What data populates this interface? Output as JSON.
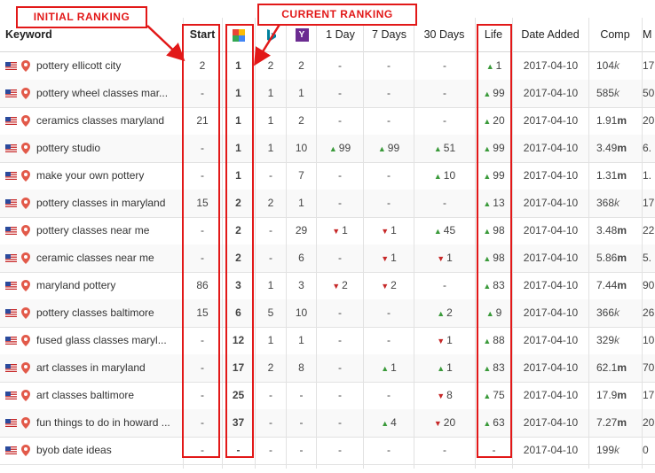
{
  "annotations": {
    "initial_label": "INITIAL RANKING",
    "current_label": "CURRENT RANKING"
  },
  "header": {
    "keyword": "Keyword",
    "start": "Start",
    "google_icon": "google-icon",
    "bing_icon": "bing-icon",
    "yahoo_icon": "yahoo-icon",
    "yahoo_glyph": "Y",
    "day1": "1 Day",
    "day7": "7 Days",
    "day30": "30 Days",
    "life": "Life",
    "date_added": "Date Added",
    "comp": "Comp",
    "m": "M"
  },
  "colors": {
    "accent_red": "#e21818",
    "up_green": "#3a9a3a",
    "down_red": "#c62828"
  },
  "rows": [
    {
      "keyword": "pottery ellicott city",
      "start": "2",
      "google": "1",
      "bing": "2",
      "yahoo": "2",
      "d1": {
        "dir": "",
        "val": "-"
      },
      "d7": {
        "dir": "",
        "val": "-"
      },
      "d30": {
        "dir": "",
        "val": "-"
      },
      "life": {
        "dir": "up",
        "val": "1"
      },
      "date": "2017-04-10",
      "comp_num": "104",
      "comp_unit": "k",
      "m": "17"
    },
    {
      "keyword": "pottery wheel classes mar...",
      "start": "-",
      "google": "1",
      "bing": "1",
      "yahoo": "1",
      "d1": {
        "dir": "",
        "val": "-"
      },
      "d7": {
        "dir": "",
        "val": "-"
      },
      "d30": {
        "dir": "",
        "val": "-"
      },
      "life": {
        "dir": "up",
        "val": "99"
      },
      "date": "2017-04-10",
      "comp_num": "585",
      "comp_unit": "k",
      "m": "50"
    },
    {
      "keyword": "ceramics classes maryland",
      "start": "21",
      "google": "1",
      "bing": "1",
      "yahoo": "2",
      "d1": {
        "dir": "",
        "val": "-"
      },
      "d7": {
        "dir": "",
        "val": "-"
      },
      "d30": {
        "dir": "",
        "val": "-"
      },
      "life": {
        "dir": "up",
        "val": "20"
      },
      "date": "2017-04-10",
      "comp_num": "1.91",
      "comp_unit": "m",
      "m": "20"
    },
    {
      "keyword": "pottery studio",
      "start": "-",
      "google": "1",
      "bing": "1",
      "yahoo": "10",
      "d1": {
        "dir": "up",
        "val": "99"
      },
      "d7": {
        "dir": "up",
        "val": "99"
      },
      "d30": {
        "dir": "up",
        "val": "51"
      },
      "life": {
        "dir": "up",
        "val": "99"
      },
      "date": "2017-04-10",
      "comp_num": "3.49",
      "comp_unit": "m",
      "m": "6."
    },
    {
      "keyword": "make your own pottery",
      "start": "-",
      "google": "1",
      "bing": "-",
      "yahoo": "7",
      "d1": {
        "dir": "",
        "val": "-"
      },
      "d7": {
        "dir": "",
        "val": "-"
      },
      "d30": {
        "dir": "up",
        "val": "10"
      },
      "life": {
        "dir": "up",
        "val": "99"
      },
      "date": "2017-04-10",
      "comp_num": "1.31",
      "comp_unit": "m",
      "m": "1."
    },
    {
      "keyword": "pottery classes in maryland",
      "start": "15",
      "google": "2",
      "bing": "2",
      "yahoo": "1",
      "d1": {
        "dir": "",
        "val": "-"
      },
      "d7": {
        "dir": "",
        "val": "-"
      },
      "d30": {
        "dir": "",
        "val": "-"
      },
      "life": {
        "dir": "up",
        "val": "13"
      },
      "date": "2017-04-10",
      "comp_num": "368",
      "comp_unit": "k",
      "m": "17"
    },
    {
      "keyword": "pottery classes near me",
      "start": "-",
      "google": "2",
      "bing": "-",
      "yahoo": "29",
      "d1": {
        "dir": "down",
        "val": "1"
      },
      "d7": {
        "dir": "down",
        "val": "1"
      },
      "d30": {
        "dir": "up",
        "val": "45"
      },
      "life": {
        "dir": "up",
        "val": "98"
      },
      "date": "2017-04-10",
      "comp_num": "3.48",
      "comp_unit": "m",
      "m": "22"
    },
    {
      "keyword": "ceramic classes near me",
      "start": "-",
      "google": "2",
      "bing": "-",
      "yahoo": "6",
      "d1": {
        "dir": "",
        "val": "-"
      },
      "d7": {
        "dir": "down",
        "val": "1"
      },
      "d30": {
        "dir": "down",
        "val": "1"
      },
      "life": {
        "dir": "up",
        "val": "98"
      },
      "date": "2017-04-10",
      "comp_num": "5.86",
      "comp_unit": "m",
      "m": "5."
    },
    {
      "keyword": "maryland pottery",
      "start": "86",
      "google": "3",
      "bing": "1",
      "yahoo": "3",
      "d1": {
        "dir": "down",
        "val": "2"
      },
      "d7": {
        "dir": "down",
        "val": "2"
      },
      "d30": {
        "dir": "",
        "val": "-"
      },
      "life": {
        "dir": "up",
        "val": "83"
      },
      "date": "2017-04-10",
      "comp_num": "7.44",
      "comp_unit": "m",
      "m": "90"
    },
    {
      "keyword": "pottery classes baltimore",
      "start": "15",
      "google": "6",
      "bing": "5",
      "yahoo": "10",
      "d1": {
        "dir": "",
        "val": "-"
      },
      "d7": {
        "dir": "",
        "val": "-"
      },
      "d30": {
        "dir": "up",
        "val": "2"
      },
      "life": {
        "dir": "up",
        "val": "9"
      },
      "date": "2017-04-10",
      "comp_num": "366",
      "comp_unit": "k",
      "m": "26"
    },
    {
      "keyword": "fused glass classes maryl...",
      "start": "-",
      "google": "12",
      "bing": "1",
      "yahoo": "1",
      "d1": {
        "dir": "",
        "val": "-"
      },
      "d7": {
        "dir": "",
        "val": "-"
      },
      "d30": {
        "dir": "down",
        "val": "1"
      },
      "life": {
        "dir": "up",
        "val": "88"
      },
      "date": "2017-04-10",
      "comp_num": "329",
      "comp_unit": "k",
      "m": "10"
    },
    {
      "keyword": "art classes in maryland",
      "start": "-",
      "google": "17",
      "bing": "2",
      "yahoo": "8",
      "d1": {
        "dir": "",
        "val": "-"
      },
      "d7": {
        "dir": "up",
        "val": "1"
      },
      "d30": {
        "dir": "up",
        "val": "1"
      },
      "life": {
        "dir": "up",
        "val": "83"
      },
      "date": "2017-04-10",
      "comp_num": "62.1",
      "comp_unit": "m",
      "m": "70"
    },
    {
      "keyword": "art classes baltimore",
      "start": "-",
      "google": "25",
      "bing": "-",
      "yahoo": "-",
      "d1": {
        "dir": "",
        "val": "-"
      },
      "d7": {
        "dir": "",
        "val": "-"
      },
      "d30": {
        "dir": "down",
        "val": "8"
      },
      "life": {
        "dir": "up",
        "val": "75"
      },
      "date": "2017-04-10",
      "comp_num": "17.9",
      "comp_unit": "m",
      "m": "17"
    },
    {
      "keyword": "fun things to do in howard ...",
      "start": "-",
      "google": "37",
      "bing": "-",
      "yahoo": "-",
      "d1": {
        "dir": "",
        "val": "-"
      },
      "d7": {
        "dir": "up",
        "val": "4"
      },
      "d30": {
        "dir": "down",
        "val": "20"
      },
      "life": {
        "dir": "up",
        "val": "63"
      },
      "date": "2017-04-10",
      "comp_num": "7.27",
      "comp_unit": "m",
      "m": "20"
    },
    {
      "keyword": "byob date ideas",
      "start": "-",
      "google": "-",
      "bing": "-",
      "yahoo": "-",
      "d1": {
        "dir": "",
        "val": "-"
      },
      "d7": {
        "dir": "",
        "val": "-"
      },
      "d30": {
        "dir": "",
        "val": "-"
      },
      "life": {
        "dir": "",
        "val": "-"
      },
      "date": "2017-04-10",
      "comp_num": "199",
      "comp_unit": "k",
      "m": "0"
    }
  ]
}
